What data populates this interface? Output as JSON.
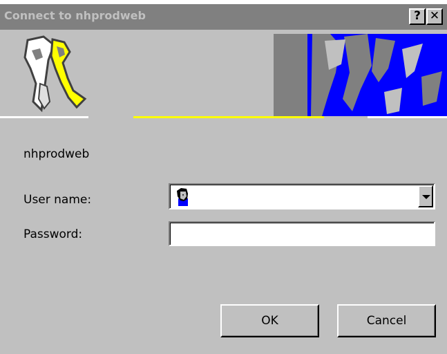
{
  "window": {
    "title": "Connect to nhprodweb",
    "help_glyph": "?",
    "close_glyph": "✕"
  },
  "dialog": {
    "server_name": "nhprodweb",
    "username_label": "User name:",
    "username_value": "",
    "password_label": "Password:",
    "password_value": "",
    "ok_label": "OK",
    "cancel_label": "Cancel"
  },
  "icons": {
    "banner_keys": "keys-icon",
    "user_avatar": "user-avatar-icon",
    "dropdown": "chevron-down-icon"
  },
  "colors": {
    "face": "#c0c0c0",
    "titlebar_inactive": "#808080",
    "banner_blue": "#0000ff",
    "banner_yellow": "#ffff00"
  }
}
